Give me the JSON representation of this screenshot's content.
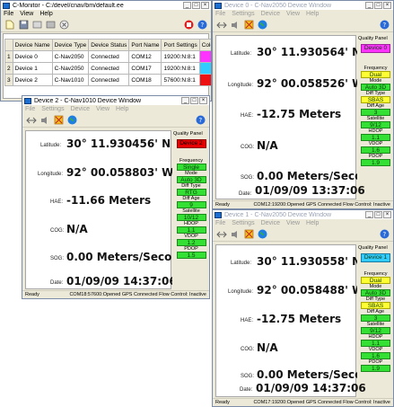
{
  "main": {
    "title": "C-Monitor - C:/devel/cnav/bm/default.ee",
    "menu": [
      "File",
      "View",
      "Help"
    ],
    "columns": [
      "Device Name",
      "Device Type",
      "Device Status",
      "Port Name",
      "Port Settings",
      "Color"
    ],
    "rows": [
      {
        "num": "1",
        "name": "Device 0",
        "type": "C-Nav2050",
        "status": "Connected",
        "port": "COM12",
        "settings": "19200:N:8:1",
        "color": "#ff33ff"
      },
      {
        "num": "2",
        "name": "Device 1",
        "type": "C-Nav2050",
        "status": "Connected",
        "port": "COM17",
        "settings": "19200:N:8:1",
        "color": "#33ccff"
      },
      {
        "num": "3",
        "name": "Device 2",
        "type": "C-Nav1010",
        "status": "Connected",
        "port": "COM18",
        "settings": "57600:N:8:1",
        "color": "#ee1111"
      }
    ]
  },
  "labels": {
    "latitude": "Latitude:",
    "longitude": "Longitude:",
    "hae": "HAE:",
    "cog": "COG:",
    "sog": "SOG:",
    "date": "Date:",
    "quality_panel": "Quality Panel",
    "ready": "Ready",
    "menu": [
      "File",
      "Settings",
      "Device",
      "View",
      "Help"
    ],
    "q_frequency": "Frequency",
    "q_mode": "Mode",
    "q_diff_type": "Diff Type",
    "q_diff_age": "Diff Age",
    "q_satellite": "Satellite",
    "q_hdop": "HDOP",
    "q_vdop": "VDOP",
    "q_pdop": "PDOP"
  },
  "win0": {
    "title": "Device 0 - C-Nav2050 Device Window",
    "latitude": "30° 11.930564' N",
    "longitude": "92° 00.058526' W",
    "hae": "-12.75 Meters",
    "cog": "N/A",
    "sog": "0.00 Meters/Second",
    "date": "01/09/09 13:37:06",
    "device_badge": "Device 0",
    "frequency": "Dual",
    "mode": "Auto 3D",
    "diff_type": "SBAS",
    "diff_age": "3",
    "satellite": "9/12",
    "hdop": "1.1",
    "vdop": "1.6",
    "pdop": "1.9",
    "status": "COM12:19200:Opened  GPS Connected  Flow Control: Inactive",
    "badge_color": "#ff33ff"
  },
  "win1": {
    "title": "Device 1 - C-Nav2050 Device Window",
    "latitude": "30° 11.930558' N",
    "longitude": "92° 00.058488' W",
    "hae": "-12.75 Meters",
    "cog": "N/A",
    "sog": "0.00 Meters/Second",
    "date": "01/09/09 14:37:06",
    "device_badge": "Device 1",
    "frequency": "Dual",
    "mode": "Auto 3D",
    "diff_type": "SBAS",
    "diff_age": "3",
    "satellite": "9/12",
    "hdop": "1.1",
    "vdop": "1.6",
    "pdop": "1.9",
    "status": "COM17:19200:Opened  GPS Connected  Flow Control: Inactive",
    "badge_color": "#33ccff"
  },
  "win2": {
    "title": "Device 2 - C-Nav1010 Device Window",
    "latitude": "30° 11.930456' N",
    "longitude": "92° 00.058803' W",
    "hae": "-11.66 Meters",
    "cog": "N/A",
    "sog": "0.00 Meters/Second",
    "date": "01/09/09 14:37:06",
    "device_badge": "Device 2",
    "frequency": "Single",
    "mode": "Auto 3D",
    "diff_type": "RTG",
    "diff_age": "9",
    "satellite": "10/12",
    "hdop": "1.1",
    "vdop": "1.2",
    "pdop": "1.5",
    "status": "COM18:57600:Opened  GPS Connected  Flow Control: Inactive",
    "badge_color": "#e80000"
  }
}
